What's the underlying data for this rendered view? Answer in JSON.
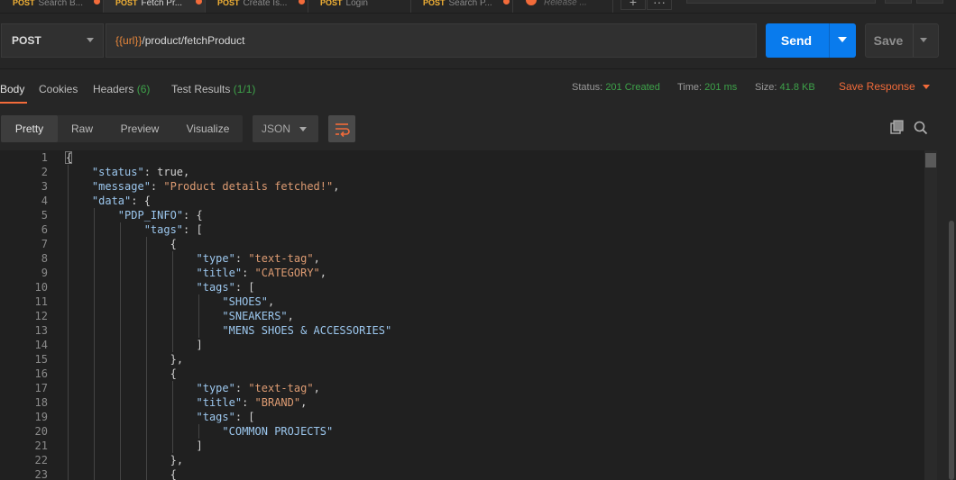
{
  "tabs": [
    {
      "method": "POST",
      "title": "Search B..."
    },
    {
      "method": "POST",
      "title": "Fetch Pr..."
    },
    {
      "method": "POST",
      "title": "Create Is..."
    },
    {
      "method": "POST",
      "title": "Login"
    },
    {
      "method": "POST",
      "title": "Search P..."
    },
    {
      "method": "",
      "title": "Release ..."
    }
  ],
  "request": {
    "method": "POST",
    "url_var": "{{url}}",
    "url_path": "/product/fetchProduct",
    "send_label": "Send",
    "save_label": "Save"
  },
  "response_tabs": [
    {
      "label": "Body",
      "count": ""
    },
    {
      "label": "Cookies",
      "count": ""
    },
    {
      "label": "Headers",
      "count": "(6)"
    },
    {
      "label": "Test Results",
      "count": "(1/1)"
    }
  ],
  "meta": {
    "status_label": "Status:",
    "status_value": "201 Created",
    "time_label": "Time:",
    "time_value": "201 ms",
    "size_label": "Size:",
    "size_value": "41.8 KB",
    "save_response": "Save Response"
  },
  "view_modes": [
    "Pretty",
    "Raw",
    "Preview",
    "Visualize"
  ],
  "format": "JSON",
  "colors": {
    "accent": "#f26b3a",
    "send": "#097bed",
    "success": "#3ea34a",
    "key": "#9cc7ee",
    "string": "#dd9b72"
  },
  "icons": {
    "copy": "copy-icon",
    "search": "search-icon",
    "wrap": "wrap-lines-icon"
  },
  "code_lines": [
    {
      "n": "1",
      "parts": [
        [
          "b",
          "{"
        ]
      ]
    },
    {
      "n": "2",
      "parts": [
        [
          "k",
          "\"status\""
        ],
        [
          "p",
          ": true,"
        ]
      ]
    },
    {
      "n": "3",
      "parts": [
        [
          "k",
          "\"message\""
        ],
        [
          "p",
          ": "
        ],
        [
          "s",
          "\"Product details fetched!\""
        ],
        [
          "p",
          ","
        ]
      ]
    },
    {
      "n": "4",
      "parts": [
        [
          "k",
          "\"data\""
        ],
        [
          "p",
          ": {"
        ]
      ]
    },
    {
      "n": "5",
      "parts": [
        [
          "k",
          "\"PDP_INFO\""
        ],
        [
          "p",
          ": {"
        ]
      ]
    },
    {
      "n": "6",
      "parts": [
        [
          "k",
          "\"tags\""
        ],
        [
          "p",
          ": ["
        ]
      ]
    },
    {
      "n": "7",
      "parts": [
        [
          "p",
          "{"
        ]
      ]
    },
    {
      "n": "8",
      "parts": [
        [
          "k",
          "\"type\""
        ],
        [
          "p",
          ": "
        ],
        [
          "s",
          "\"text-tag\""
        ],
        [
          "p",
          ","
        ]
      ]
    },
    {
      "n": "9",
      "parts": [
        [
          "k",
          "\"title\""
        ],
        [
          "p",
          ": "
        ],
        [
          "s",
          "\"CATEGORY\""
        ],
        [
          "p",
          ","
        ]
      ]
    },
    {
      "n": "10",
      "parts": [
        [
          "k",
          "\"tags\""
        ],
        [
          "p",
          ": ["
        ]
      ]
    },
    {
      "n": "11",
      "parts": [
        [
          "k",
          "\"SHOES\""
        ],
        [
          "p",
          ","
        ]
      ]
    },
    {
      "n": "12",
      "parts": [
        [
          "k",
          "\"SNEAKERS\""
        ],
        [
          "p",
          ","
        ]
      ]
    },
    {
      "n": "13",
      "parts": [
        [
          "k",
          "\"MENS SHOES & ACCESSORIES\""
        ]
      ]
    },
    {
      "n": "14",
      "parts": [
        [
          "p",
          "]"
        ]
      ]
    },
    {
      "n": "15",
      "parts": [
        [
          "p",
          "},"
        ]
      ]
    },
    {
      "n": "16",
      "parts": [
        [
          "p",
          "{"
        ]
      ]
    },
    {
      "n": "17",
      "parts": [
        [
          "k",
          "\"type\""
        ],
        [
          "p",
          ": "
        ],
        [
          "s",
          "\"text-tag\""
        ],
        [
          "p",
          ","
        ]
      ]
    },
    {
      "n": "18",
      "parts": [
        [
          "k",
          "\"title\""
        ],
        [
          "p",
          ": "
        ],
        [
          "s",
          "\"BRAND\""
        ],
        [
          "p",
          ","
        ]
      ]
    },
    {
      "n": "19",
      "parts": [
        [
          "k",
          "\"tags\""
        ],
        [
          "p",
          ": ["
        ]
      ]
    },
    {
      "n": "20",
      "parts": [
        [
          "k",
          "\"COMMON PROJECTS\""
        ]
      ]
    },
    {
      "n": "21",
      "parts": [
        [
          "p",
          "]"
        ]
      ]
    },
    {
      "n": "22",
      "parts": [
        [
          "p",
          "},"
        ]
      ]
    },
    {
      "n": "23",
      "parts": [
        [
          "p",
          "{"
        ]
      ]
    }
  ]
}
